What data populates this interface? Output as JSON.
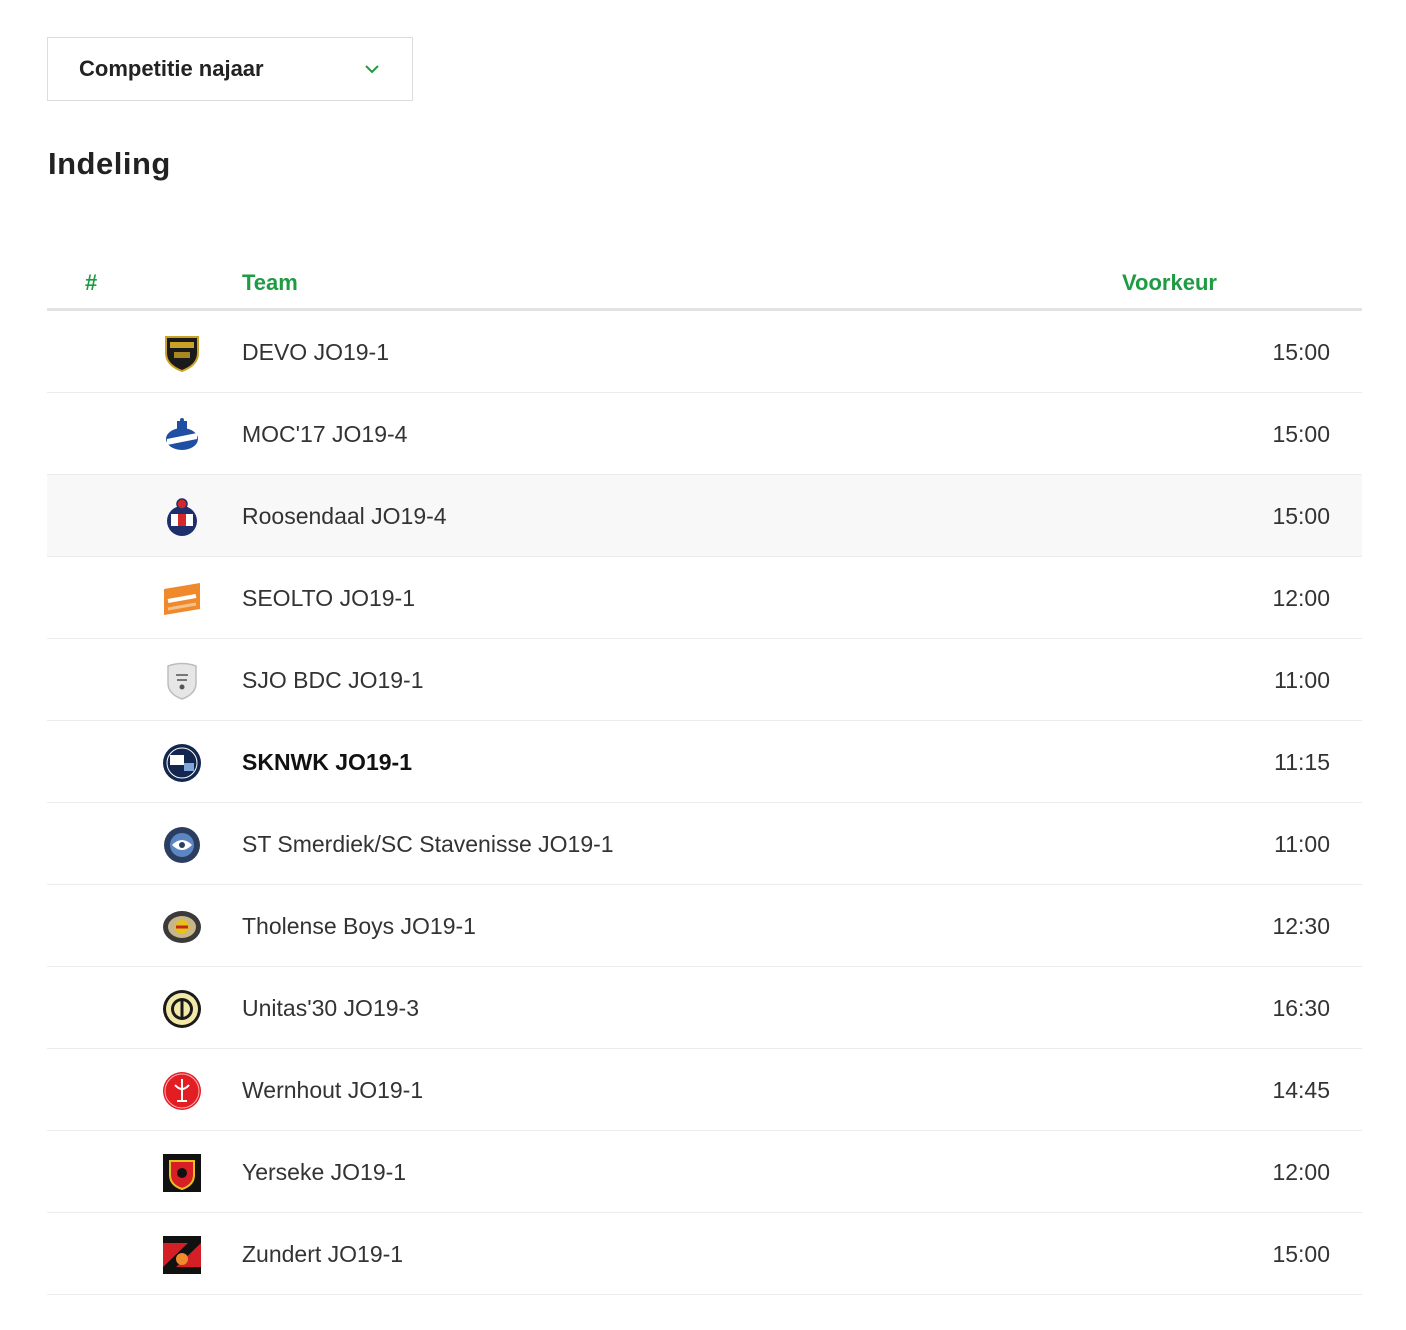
{
  "selector": {
    "label": "Competitie najaar",
    "icon": "chevron-down-icon"
  },
  "title": "Indeling",
  "columns": {
    "number": "#",
    "team": "Team",
    "preference": "Voorkeur"
  },
  "accent_color": "#1e9b43",
  "teams": [
    {
      "name": "DEVO JO19-1",
      "time": "15:00",
      "logo": "devo-logo"
    },
    {
      "name": "MOC'17 JO19-4",
      "time": "15:00",
      "logo": "moc17-logo"
    },
    {
      "name": "Roosendaal JO19-4",
      "time": "15:00",
      "logo": "roosendaal-logo"
    },
    {
      "name": "SEOLTO JO19-1",
      "time": "12:00",
      "logo": "seolto-logo"
    },
    {
      "name": "SJO BDC JO19-1",
      "time": "11:00",
      "logo": "placeholder-shield-logo"
    },
    {
      "name": "SKNWK JO19-1",
      "time": "11:15",
      "logo": "sknwk-logo",
      "own_team": true
    },
    {
      "name": "ST Smerdiek/SC Stavenisse JO19-1",
      "time": "11:00",
      "logo": "smerdiek-logo"
    },
    {
      "name": "Tholense Boys JO19-1",
      "time": "12:30",
      "logo": "tholense-boys-logo"
    },
    {
      "name": "Unitas'30 JO19-3",
      "time": "16:30",
      "logo": "unitas30-logo"
    },
    {
      "name": "Wernhout JO19-1",
      "time": "14:45",
      "logo": "wernhout-logo"
    },
    {
      "name": "Yerseke JO19-1",
      "time": "12:00",
      "logo": "yerseke-logo"
    },
    {
      "name": "Zundert JO19-1",
      "time": "15:00",
      "logo": "zundert-logo"
    }
  ]
}
